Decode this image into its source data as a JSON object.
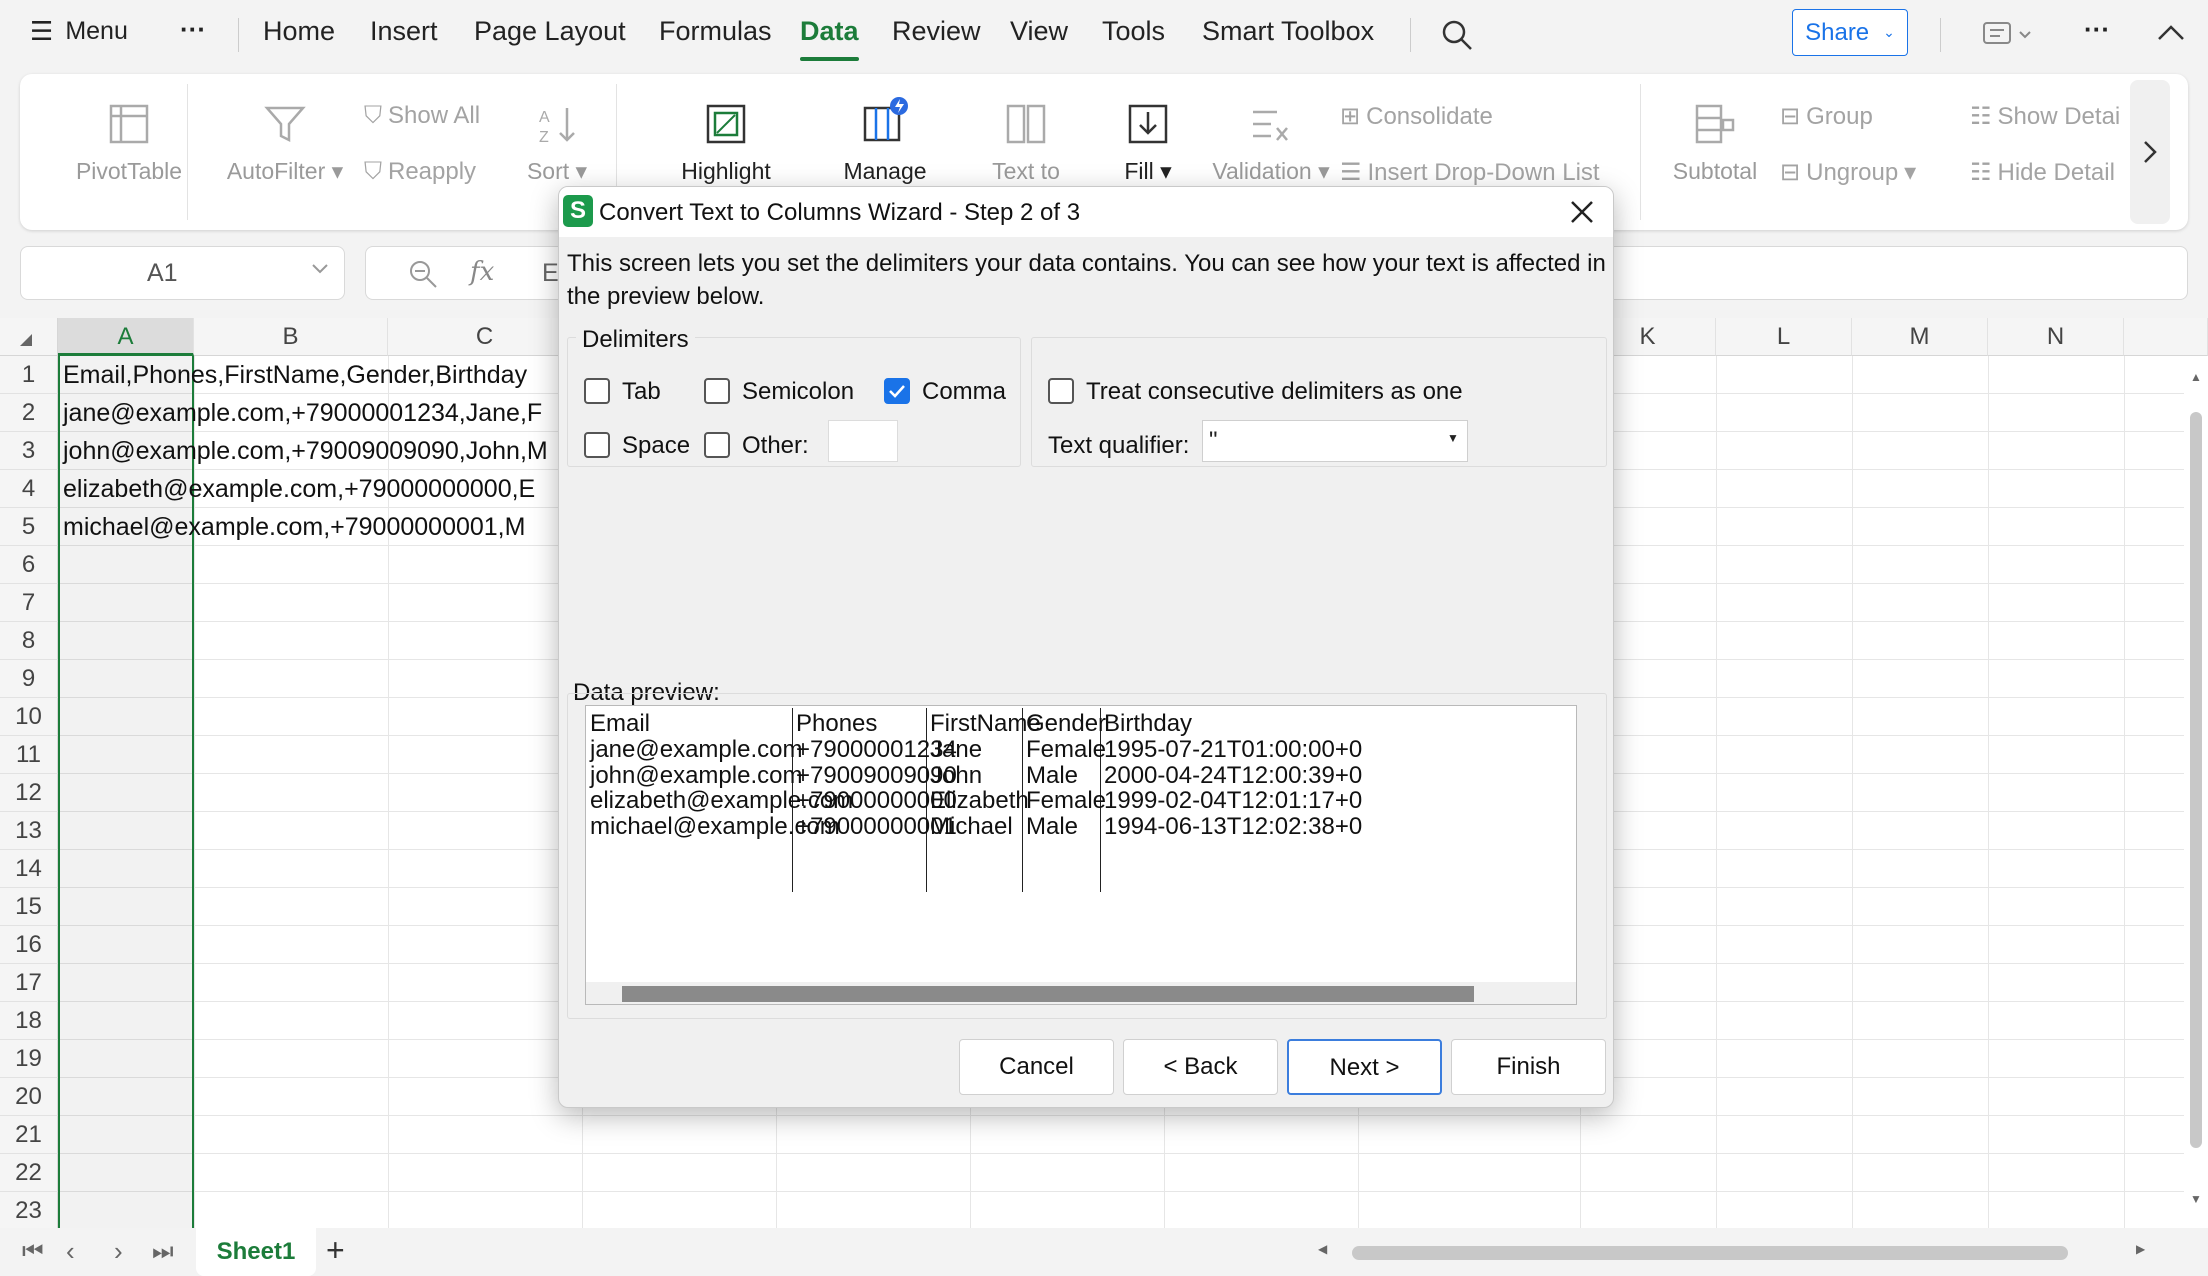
{
  "menubar": {
    "menu_label": "Menu",
    "more": "···",
    "tabs": [
      "Home",
      "Insert",
      "Page Layout",
      "Formulas",
      "Data",
      "Review",
      "View",
      "Tools",
      "Smart Toolbox"
    ],
    "active_tab": "Data",
    "share_label": "Share"
  },
  "ribbon": {
    "pivot": "PivotTable",
    "autofilter": "AutoFilter",
    "show_all": "Show All",
    "reapply": "Reapply",
    "sort": "Sort",
    "highlight": "Highlight",
    "manage": "Manage",
    "text_to": "Text to",
    "fill": "Fill",
    "validation": "Validation",
    "consolidate": "Consolidate",
    "insert_dropdown": "Insert Drop-Down List",
    "subtotal": "Subtotal",
    "group": "Group",
    "ungroup": "Ungroup",
    "show_detail": "Show Detai",
    "hide_detail": "Hide Detail"
  },
  "formula": {
    "namebox": "A1",
    "fx": "fx",
    "content_partial": "E"
  },
  "grid": {
    "columns": [
      "A",
      "B",
      "C",
      "K",
      "L",
      "M",
      "N"
    ],
    "rows": [
      "1",
      "2",
      "3",
      "4",
      "5",
      "6",
      "7",
      "8",
      "9",
      "10",
      "11",
      "12",
      "13",
      "14",
      "15",
      "16",
      "17",
      "18",
      "19",
      "20",
      "21",
      "22",
      "23"
    ],
    "cells": [
      "Email,Phones,FirstName,Gender,Birthday",
      "jane@example.com,+79000001234,Jane,F",
      "john@example.com,+79009009090,John,M",
      "elizabeth@example.com,+79000000000,E",
      "michael@example.com,+79000000001,M"
    ]
  },
  "sheets": {
    "active": "Sheet1",
    "add": "+"
  },
  "dialog": {
    "title": "Convert Text to Columns Wizard - Step 2 of 3",
    "description": "This screen lets you set the delimiters your data contains. You can see how your text is affected in the preview below.",
    "delimiters_label": "Delimiters",
    "tab": "Tab",
    "semicolon": "Semicolon",
    "comma": "Comma",
    "space": "Space",
    "other": "Other:",
    "other_value": "",
    "consecutive": "Treat consecutive delimiters as one",
    "qualifier_label": "Text qualifier:",
    "qualifier_value": "\"",
    "checked": {
      "tab": false,
      "semicolon": false,
      "comma": true,
      "space": false,
      "other": false,
      "consecutive": false
    },
    "preview_label": "Data preview:",
    "preview_headers": [
      "Email",
      "Phones",
      "FirstName",
      "Gender",
      "Birthday"
    ],
    "preview_rows": [
      [
        "jane@example.com",
        "+79000001234",
        "Jane",
        "Female",
        "1995-07-21T01:00:00+0"
      ],
      [
        "john@example.com",
        "+79009009090",
        "John",
        "Male",
        "2000-04-24T12:00:39+0"
      ],
      [
        "elizabeth@example.com",
        "+79000000000",
        "Elizabeth",
        "Female",
        "1999-02-04T12:01:17+0"
      ],
      [
        "michael@example.com",
        "+79000000001",
        "Michael",
        "Male",
        "1994-06-13T12:02:38+0"
      ]
    ],
    "buttons": {
      "cancel": "Cancel",
      "back": "< Back",
      "next": "Next >",
      "finish": "Finish"
    }
  },
  "colors": {
    "accent": "#1c7c3a",
    "checkbox": "#1a73e8",
    "share": "#1a73e8"
  }
}
